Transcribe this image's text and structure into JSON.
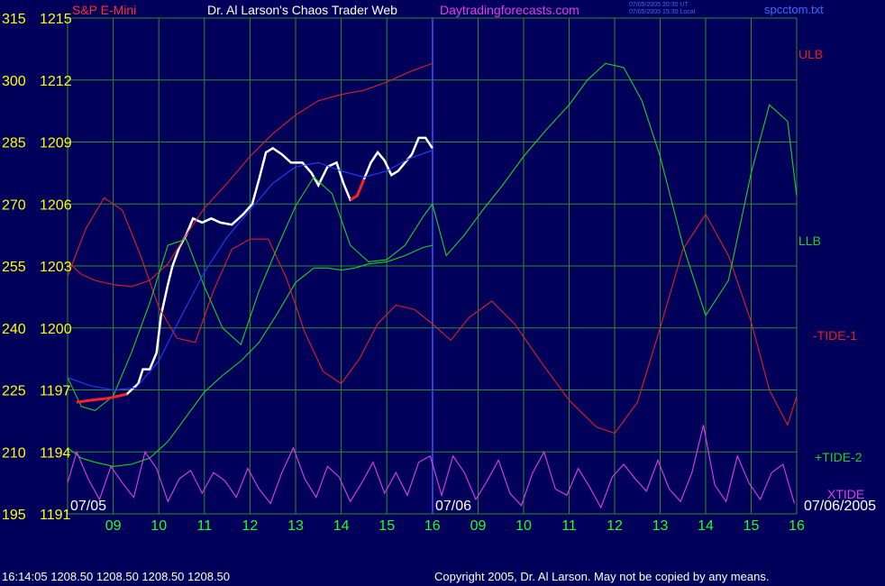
{
  "header": {
    "instrument": "S&P E-Mini",
    "title": "Dr. Al Larson's Chaos Trader Web",
    "site": "Daytradingforecasts.com",
    "stamp_line1": "07/05/2005 20:30 UT",
    "stamp_line2": "07/05/2005 15:30 Local",
    "file": "spcctom.txt"
  },
  "footer": {
    "quote": "16:14:05  1208.50  1208.50  1208.50  1208.50",
    "copyright": "Copyright 2005, Dr. Al Larson. May not be copied by any means."
  },
  "colors": {
    "background": "#00005a",
    "grid": "#2f8a2f",
    "price": "#ffffff",
    "price_red": "#ff2020",
    "ulb": "#e02020",
    "llb": "#20d020",
    "tide1": "#e02020",
    "tide2": "#20d020",
    "xtide": "#e040e0",
    "avg": "#2040ff",
    "axis_yellow": "#ffff00",
    "axis_green": "#20ff20"
  },
  "chart_data": {
    "type": "line",
    "xlabel": "",
    "ylabel": "",
    "x_hours": [
      9,
      10,
      11,
      12,
      13,
      14,
      15,
      16,
      9,
      10,
      11,
      12,
      13,
      14,
      15,
      16
    ],
    "x_tick_labels": [
      "09",
      "10",
      "11",
      "12",
      "13",
      "14",
      "15",
      "16",
      "09",
      "10",
      "11",
      "12",
      "13",
      "14",
      "15",
      "16"
    ],
    "date_labels": [
      "07/05",
      "07/06",
      "07/06/2005"
    ],
    "y_left_ticks": [
      315,
      300,
      285,
      270,
      255,
      240,
      225,
      210,
      195
    ],
    "y_right_ticks": [
      1215,
      1212,
      1209,
      1206,
      1203,
      1200,
      1197,
      1194,
      1191
    ],
    "ylim": [
      1191,
      1215
    ],
    "grid": true,
    "legend": [
      {
        "label": "ULB",
        "color_key": "ulb"
      },
      {
        "label": "LLB",
        "color_key": "llb"
      },
      {
        "label": "-TIDE-1",
        "color_key": "tide1"
      },
      {
        "label": "+TIDE-2",
        "color_key": "tide2"
      },
      {
        "label": "XTIDE",
        "color_key": "xtide"
      }
    ],
    "series": [
      {
        "name": "Price",
        "x": [
          8.2,
          8.5,
          8.9,
          9.3,
          9.55,
          9.65,
          9.8,
          9.95,
          10.05,
          10.2,
          10.3,
          10.45,
          10.6,
          10.75,
          10.95,
          11.15,
          11.35,
          11.6,
          11.85,
          12.05,
          12.2,
          12.35,
          12.5,
          12.7,
          12.9,
          13.15,
          13.35,
          13.5,
          13.7,
          13.9,
          14.05,
          14.2,
          14.35,
          14.5,
          14.65,
          14.8,
          14.95,
          15.1,
          15.25,
          15.4,
          15.55,
          15.7,
          15.85,
          16.0
        ],
        "values": [
          1196.4,
          1196.5,
          1196.6,
          1196.8,
          1197.3,
          1198.0,
          1198.0,
          1198.8,
          1200.6,
          1202.1,
          1203.0,
          1203.9,
          1204.5,
          1205.3,
          1205.1,
          1205.3,
          1205.1,
          1205.0,
          1205.5,
          1206.0,
          1207.2,
          1208.5,
          1208.7,
          1208.4,
          1208.0,
          1208.0,
          1207.5,
          1206.9,
          1207.8,
          1208.0,
          1207.0,
          1206.2,
          1206.4,
          1207.2,
          1208.0,
          1208.5,
          1208.1,
          1207.4,
          1207.6,
          1208.0,
          1208.4,
          1209.2,
          1209.2,
          1208.7
        ]
      },
      {
        "name": "ULB",
        "x": [
          8.0,
          8.3,
          8.6,
          9.0,
          9.4,
          9.8,
          10.2,
          10.6,
          11.0,
          11.5,
          12.0,
          12.5,
          13.0,
          13.5,
          14.0,
          14.5,
          15.0,
          15.5,
          16.0
        ],
        "values": [
          1203.2,
          1202.6,
          1202.3,
          1202.1,
          1202.0,
          1202.3,
          1203.1,
          1204.5,
          1205.8,
          1207.0,
          1208.3,
          1209.4,
          1210.3,
          1211.0,
          1211.3,
          1211.5,
          1211.9,
          1212.4,
          1212.8
        ]
      },
      {
        "name": "LLB",
        "x": [
          8.0,
          8.3,
          8.6,
          9.0,
          9.4,
          9.8,
          10.2,
          10.6,
          11.0,
          11.4,
          11.8,
          12.2,
          12.6,
          13.0,
          13.4,
          13.7,
          14.0,
          14.3,
          14.6,
          15.0,
          15.4,
          15.8,
          16.0
        ],
        "values": [
          1194.2,
          1193.7,
          1193.5,
          1193.3,
          1193.4,
          1193.7,
          1194.5,
          1195.7,
          1196.9,
          1197.7,
          1198.4,
          1199.3,
          1200.7,
          1202.2,
          1202.9,
          1202.9,
          1202.8,
          1202.9,
          1203.1,
          1203.2,
          1203.5,
          1203.9,
          1204.0
        ]
      },
      {
        "name": "-TIDE-1",
        "x": [
          8.0,
          8.4,
          8.8,
          9.2,
          9.6,
          10.0,
          10.4,
          10.8,
          11.2,
          11.6,
          12.0,
          12.4,
          12.8,
          13.2,
          13.6,
          14.0,
          14.4,
          14.8,
          15.2,
          15.6,
          16.0,
          16.4,
          16.8,
          17.3,
          17.8,
          18.4,
          19.0,
          19.6,
          20.0,
          20.5,
          21.0,
          21.5,
          22.0,
          22.5,
          23.0,
          23.4,
          23.8,
          24.0
        ],
        "values": [
          1202.5,
          1204.8,
          1206.3,
          1205.7,
          1203.5,
          1201.0,
          1199.5,
          1199.3,
          1201.8,
          1203.8,
          1204.3,
          1204.3,
          1202.4,
          1199.8,
          1197.9,
          1197.3,
          1198.5,
          1200.2,
          1201.1,
          1200.9,
          1200.2,
          1199.4,
          1200.5,
          1201.3,
          1200.2,
          1198.3,
          1196.5,
          1195.2,
          1194.9,
          1196.4,
          1200.0,
          1203.8,
          1205.5,
          1203.5,
          1200.3,
          1197.0,
          1195.3,
          1196.7
        ]
      },
      {
        "name": "+TIDE-2",
        "x": [
          8.0,
          8.3,
          8.6,
          9.0,
          9.4,
          9.8,
          10.2,
          10.6,
          11.0,
          11.4,
          11.8,
          12.2,
          12.6,
          13.0,
          13.4,
          13.8,
          14.2,
          14.6,
          15.0,
          15.4,
          15.8,
          16.0,
          16.3,
          16.7,
          17.1,
          17.5,
          18.0,
          18.5,
          19.0,
          19.4,
          19.8,
          20.2,
          20.6,
          21.0,
          21.5,
          22.0,
          22.5,
          23.0,
          23.4,
          23.8,
          24.0
        ],
        "values": [
          1197.6,
          1196.2,
          1196.0,
          1196.7,
          1198.8,
          1201.2,
          1204.0,
          1204.3,
          1202.0,
          1200.0,
          1199.2,
          1201.8,
          1203.9,
          1205.9,
          1207.3,
          1206.5,
          1204.0,
          1203.2,
          1203.3,
          1204.0,
          1205.4,
          1206.0,
          1203.5,
          1204.5,
          1205.7,
          1206.8,
          1208.3,
          1209.6,
          1210.8,
          1212.0,
          1212.8,
          1212.6,
          1211.0,
          1208.3,
          1204.0,
          1200.6,
          1202.3,
          1207.5,
          1210.8,
          1210.0,
          1206.4
        ]
      },
      {
        "name": "XTIDE",
        "x": [
          8.0,
          8.2,
          8.45,
          8.7,
          8.95,
          9.2,
          9.45,
          9.7,
          9.95,
          10.2,
          10.45,
          10.7,
          10.95,
          11.2,
          11.45,
          11.7,
          11.95,
          12.2,
          12.45,
          12.7,
          12.95,
          13.2,
          13.45,
          13.7,
          13.95,
          14.2,
          14.45,
          14.7,
          14.95,
          15.2,
          15.45,
          15.7,
          15.95,
          16.2,
          16.45,
          16.7,
          16.95,
          17.2,
          17.45,
          17.7,
          17.95,
          18.2,
          18.45,
          18.7,
          18.95,
          19.2,
          19.45,
          19.7,
          19.95,
          20.2,
          20.45,
          20.7,
          20.95,
          21.2,
          21.45,
          21.7,
          21.95,
          22.2,
          22.45,
          22.7,
          22.95,
          23.2,
          23.45,
          23.7,
          23.95
        ],
        "values": [
          1192.5,
          1194.0,
          1192.7,
          1191.7,
          1193.3,
          1192.5,
          1191.8,
          1194.0,
          1193.2,
          1191.6,
          1192.7,
          1193.1,
          1192.0,
          1193.0,
          1192.6,
          1191.8,
          1193.2,
          1192.2,
          1191.5,
          1193.0,
          1194.2,
          1192.7,
          1191.8,
          1193.3,
          1192.8,
          1191.6,
          1192.5,
          1193.5,
          1192.0,
          1193.0,
          1191.9,
          1193.5,
          1193.8,
          1191.9,
          1193.8,
          1193.0,
          1191.7,
          1192.6,
          1193.6,
          1192.0,
          1191.4,
          1193.0,
          1194.0,
          1192.2,
          1191.9,
          1193.2,
          1192.3,
          1191.3,
          1192.8,
          1193.4,
          1192.7,
          1192.1,
          1193.6,
          1192.2,
          1191.6,
          1193.0,
          1195.3,
          1192.4,
          1191.6,
          1193.8,
          1192.5,
          1191.7,
          1193.0,
          1193.4,
          1191.5
        ]
      },
      {
        "name": "Avg",
        "x": [
          8.0,
          8.5,
          9.0,
          9.5,
          10.0,
          10.5,
          11.0,
          11.5,
          12.0,
          12.5,
          13.0,
          13.5,
          14.0,
          14.5,
          15.0,
          15.5,
          16.0
        ],
        "values": [
          1197.6,
          1197.2,
          1197.0,
          1197.1,
          1198.4,
          1200.6,
          1202.7,
          1204.4,
          1205.7,
          1207.0,
          1207.8,
          1208.0,
          1207.6,
          1207.3,
          1207.6,
          1208.2,
          1208.6
        ]
      }
    ]
  }
}
